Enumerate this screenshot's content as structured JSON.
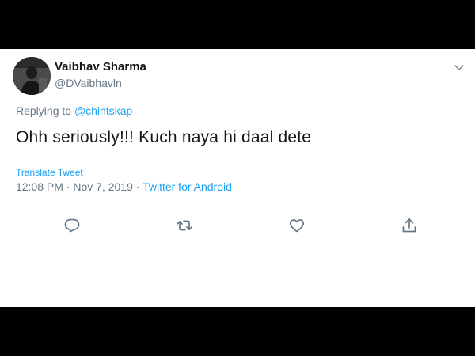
{
  "tweet": {
    "author_name": "Vaibhav Sharma",
    "author_handle": "@DVaibhavln",
    "replying_prefix": "Replying to",
    "replying_to": "@chintskap",
    "text": "Ohh seriously!!! Kuch naya hi daal dete",
    "translate_label": "Translate Tweet",
    "timestamp": "12:08 PM · Nov 7, 2019 ·",
    "source": "Twitter for Android"
  },
  "icons": {
    "menu": "chevron-down-icon",
    "reply": "reply-icon",
    "retweet": "retweet-icon",
    "like": "heart-icon",
    "share": "share-icon"
  },
  "colors": {
    "link": "#1da1f2",
    "text": "#14171a",
    "secondary": "#657786"
  }
}
